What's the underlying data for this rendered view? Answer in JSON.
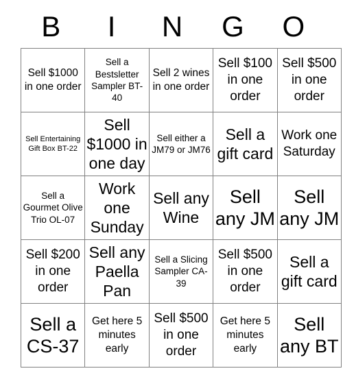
{
  "card": {
    "title": "BINGO",
    "headers": [
      {
        "letter": "B"
      },
      {
        "letter": "I"
      },
      {
        "letter": "N"
      },
      {
        "letter": "G"
      },
      {
        "letter": "O"
      }
    ],
    "grid_size": "5x5",
    "border_color": "#808080",
    "text_color": "#000000",
    "background_color": "#ffffff",
    "rows": [
      {
        "cells": [
          {
            "text": "Sell $1000 in one order",
            "size": "md"
          },
          {
            "text": "Sell a Bestsletter Sampler BT-40",
            "size": "sm"
          },
          {
            "text": "Sell 2 wines in one order",
            "size": "md"
          },
          {
            "text": "Sell $100 in one order",
            "size": "lg"
          },
          {
            "text": "Sell $500 in one order",
            "size": "lg"
          }
        ]
      },
      {
        "cells": [
          {
            "text": "Sell Entertaining Gift Box BT-22",
            "size": "xs"
          },
          {
            "text": "Sell $1000 in one day",
            "size": "xl"
          },
          {
            "text": "Sell either a JM79 or JM76",
            "size": "sm"
          },
          {
            "text": "Sell a gift card",
            "size": "xl"
          },
          {
            "text": "Work one Saturday",
            "size": "lg"
          }
        ]
      },
      {
        "cells": [
          {
            "text": "Sell a Gourmet Olive Trio OL-07",
            "size": "sm"
          },
          {
            "text": "Work one Sunday",
            "size": "xl"
          },
          {
            "text": "Sell any Wine",
            "size": "xl"
          },
          {
            "text": "Sell any JM",
            "size": "xxl"
          },
          {
            "text": "Sell any JM",
            "size": "xxl"
          }
        ]
      },
      {
        "cells": [
          {
            "text": "Sell $200 in one order",
            "size": "lg"
          },
          {
            "text": "Sell any Paella Pan",
            "size": "xl"
          },
          {
            "text": "Sell a Slicing Sampler CA-39",
            "size": "sm"
          },
          {
            "text": "Sell $500 in one order",
            "size": "lg"
          },
          {
            "text": "Sell a gift card",
            "size": "xl"
          }
        ]
      },
      {
        "cells": [
          {
            "text": "Sell a CS-37",
            "size": "xxl"
          },
          {
            "text": "Get here 5 minutes early",
            "size": "md"
          },
          {
            "text": "Sell $500 in one order",
            "size": "lg"
          },
          {
            "text": "Get here 5 minutes early",
            "size": "md"
          },
          {
            "text": "Sell any BT",
            "size": "xxl"
          }
        ]
      }
    ]
  }
}
